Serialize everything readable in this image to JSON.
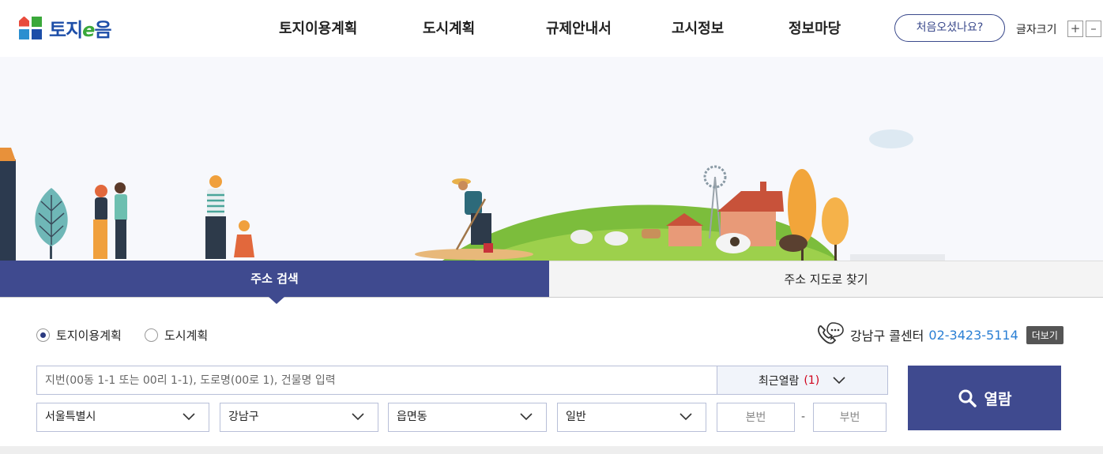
{
  "header": {
    "logo_text_a": "토지",
    "logo_text_e": "e",
    "logo_text_b": "음",
    "nav": [
      "토지이용계획",
      "도시계획",
      "규제안내서",
      "고시정보",
      "정보마당"
    ],
    "first_visit": "처음오셨나요?",
    "font_size_label": "글자크기",
    "font_plus": "+",
    "font_minus": "–"
  },
  "tabs": {
    "address_search": "주소 검색",
    "map_search": "주소 지도로 찾기"
  },
  "search": {
    "radio_land": "토지이용계획",
    "radio_city": "도시계획",
    "callcenter_label": "강남구 콜센터",
    "callcenter_phone": "02-3423-5114",
    "more": "더보기",
    "placeholder": "지번(00동 1-1 또는 00리 1-1), 도로명(00로 1), 건물명 입력",
    "recent_label": "최근열람",
    "recent_count": "(1)",
    "sido": "서울특별시",
    "sigungu": "강남구",
    "dong": "읍면동",
    "type": "일반",
    "bonbun_placeholder": "본번",
    "bubun_placeholder": "부번",
    "dash": "-",
    "view_button": "열람"
  },
  "colors": {
    "primary": "#3f4a8f",
    "phone": "#2a7fd4",
    "recent_count": "#d0021b"
  }
}
